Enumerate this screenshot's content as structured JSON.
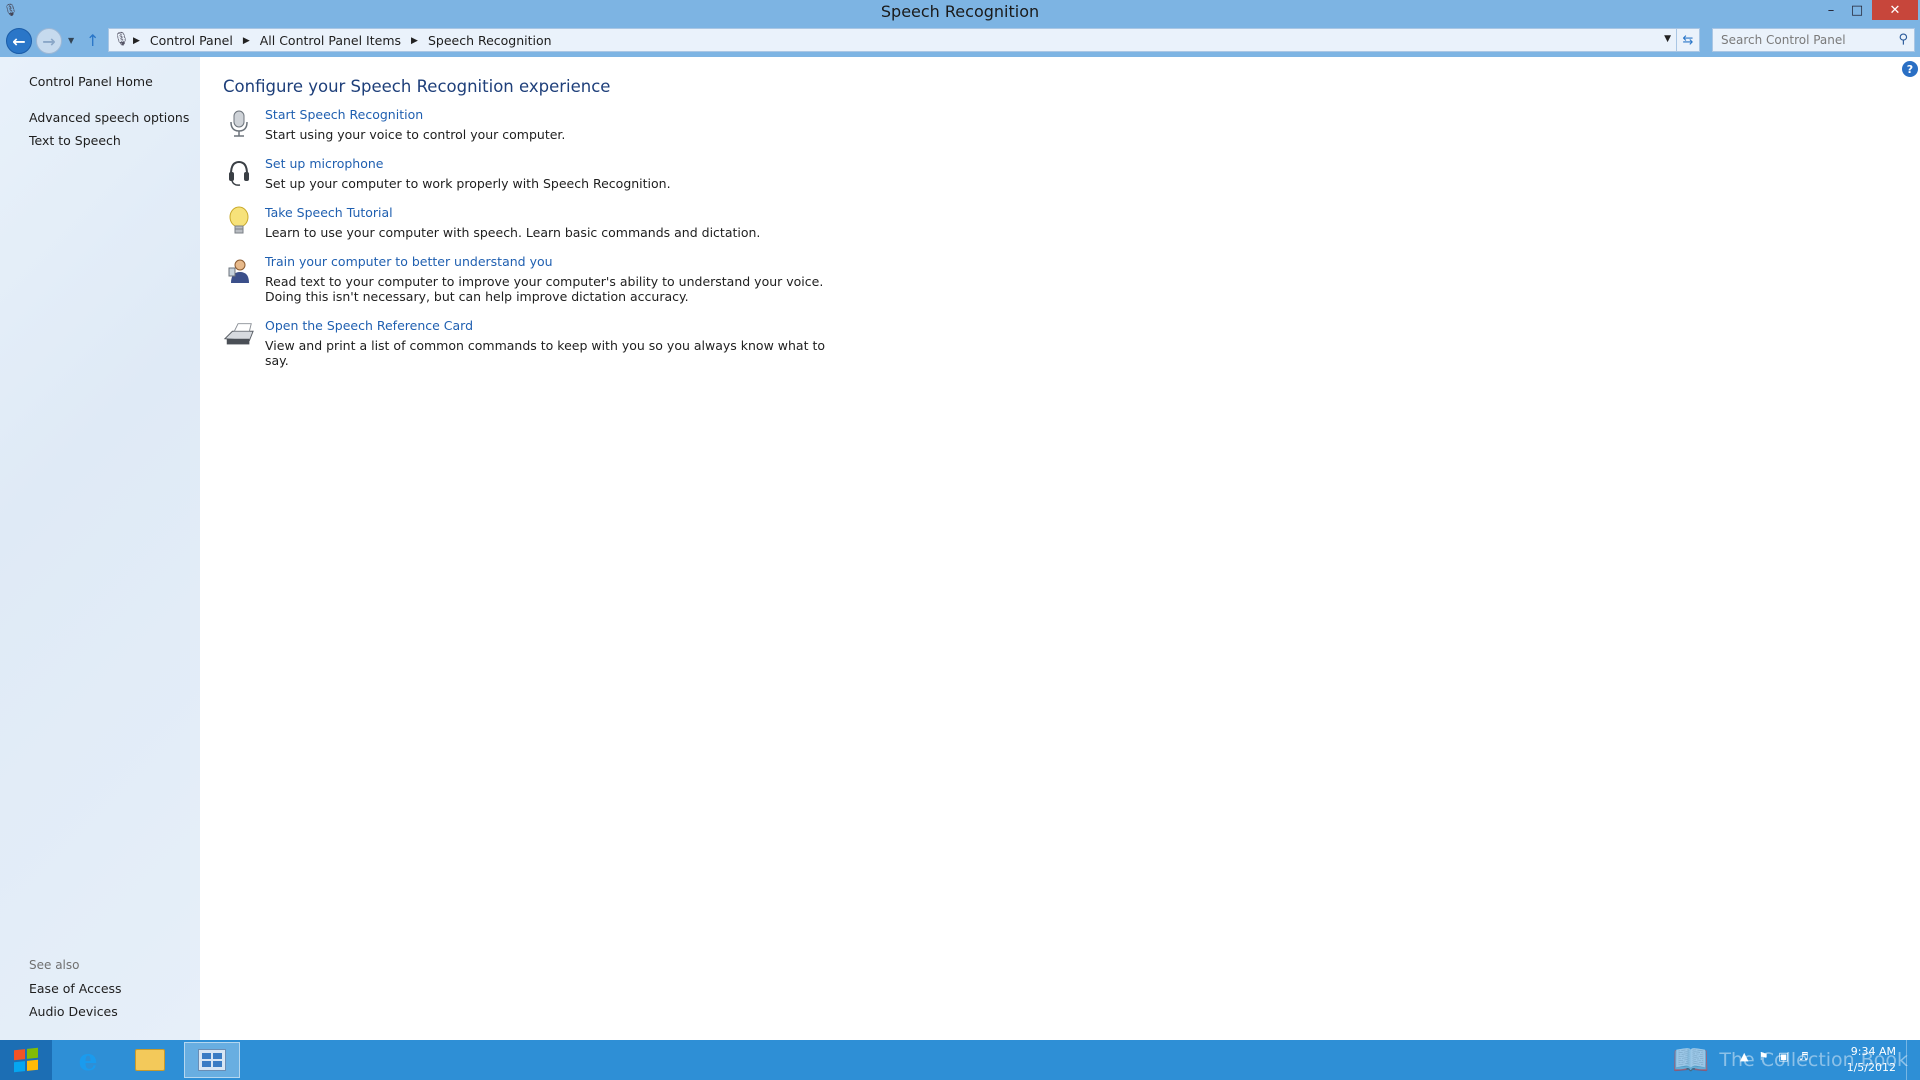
{
  "window": {
    "title": "Speech Recognition",
    "controls": {
      "minimize": "–",
      "maximize": "□",
      "close": "✕"
    }
  },
  "navbar": {
    "breadcrumbs": [
      "Control Panel",
      "All Control Panel Items",
      "Speech Recognition"
    ],
    "search_placeholder": "Search Control Panel"
  },
  "sidebar": {
    "links": [
      "Control Panel Home",
      "Advanced speech options",
      "Text to Speech"
    ],
    "see_also_label": "See also",
    "see_also_links": [
      "Ease of Access",
      "Audio Devices"
    ]
  },
  "main": {
    "heading": "Configure your Speech Recognition experience",
    "tasks": [
      {
        "icon": "microphone-icon",
        "link": "Start Speech Recognition",
        "desc": "Start using your voice to control your computer."
      },
      {
        "icon": "headset-icon",
        "link": "Set up microphone",
        "desc": "Set up your computer to work properly with Speech Recognition."
      },
      {
        "icon": "lightbulb-icon",
        "link": "Take Speech Tutorial",
        "desc": "Learn to use your computer with speech.  Learn basic commands and dictation."
      },
      {
        "icon": "user-train-icon",
        "link": "Train your computer to better understand you",
        "desc": "Read text to your computer to improve your computer's ability to understand your voice.  Doing this isn't necessary, but can help improve dictation accuracy."
      },
      {
        "icon": "printer-icon",
        "link": "Open the Speech Reference Card",
        "desc": "View and print a list of common commands to keep with you so you always know what to say."
      }
    ]
  },
  "taskbar": {
    "watermark": "The Collection Book",
    "time": "9:34 AM",
    "date": "1/5/2012"
  },
  "colors": {
    "titlebar": "#7db4e3",
    "link": "#1f5fb0",
    "heading": "#1e3f7a",
    "taskbar": "#2e8fd6",
    "close": "#c7463b"
  }
}
